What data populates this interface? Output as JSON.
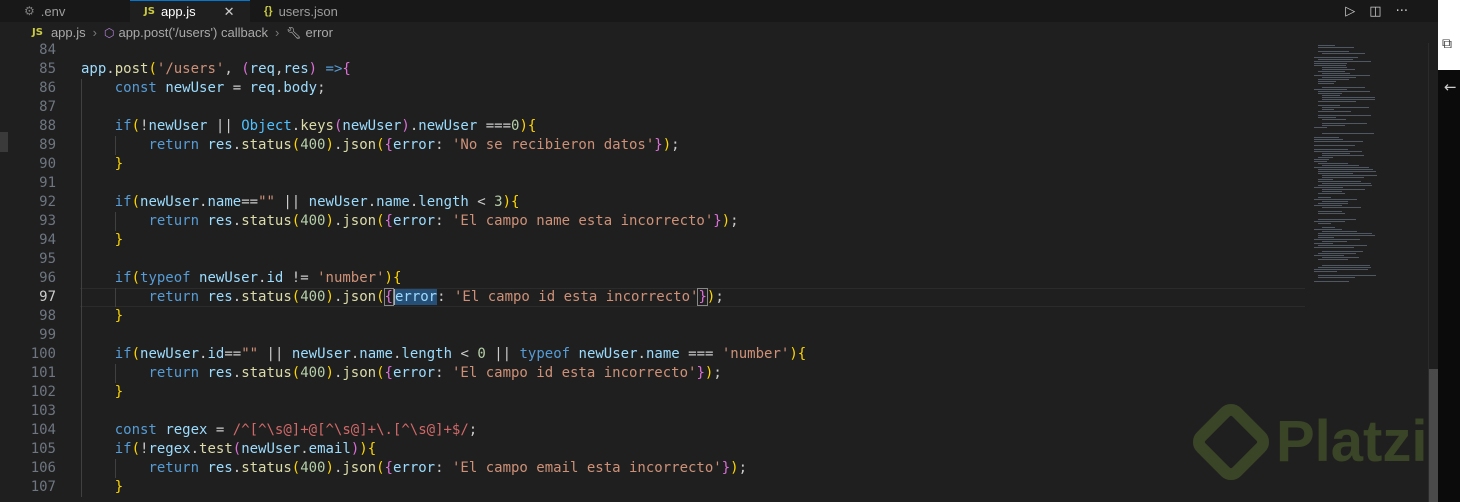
{
  "tabs": [
    {
      "label": ".env",
      "icon": "gear-icon"
    },
    {
      "label": "app.js",
      "icon": "js-icon",
      "badge": "JS"
    },
    {
      "label": "users.json",
      "icon": "json-icon",
      "badge": "{}"
    }
  ],
  "breadcrumb": {
    "badge": "JS",
    "file": "app.js",
    "symbol": "app.post('/users') callback",
    "leaf": "error"
  },
  "editor": {
    "current_line": 97,
    "line_numbers": [
      "84",
      "85",
      "86",
      "87",
      "88",
      "89",
      "90",
      "91",
      "92",
      "93",
      "94",
      "95",
      "96",
      "97",
      "98",
      "99",
      "100",
      "101",
      "102",
      "103",
      "104",
      "105",
      "106",
      "107"
    ],
    "lines": [
      "",
      "app.post('/users', (req,res) =>{",
      "    const newUser = req.body;",
      "",
      "    if(!newUser || Object.keys(newUser).newUser ===0){",
      "        return res.status(400).json({error: 'No se recibieron datos'});",
      "    }",
      "",
      "    if(newUser.name==\"\" || newUser.name.length < 3){",
      "        return res.status(400).json({error: 'El campo name esta incorrecto'});",
      "    }",
      "",
      "    if(typeof newUser.id != 'number'){",
      "        return res.status(400).json({error: 'El campo id esta incorrecto'});",
      "    }",
      "",
      "    if(newUser.id==\"\" || newUser.name.length < 0 || typeof newUser.name === 'number'){",
      "        return res.status(400).json({error: 'El campo id esta incorrecto'});",
      "    }",
      "",
      "    const regex = /^[^\\s@]+@[^\\s@]+\\.[^\\s@]+$/;",
      "    if(!regex.test(newUser.email)){",
      "        return res.status(400).json({error: 'El campo email esta incorrecto'});",
      "    }"
    ]
  },
  "watermark": "Platzi"
}
